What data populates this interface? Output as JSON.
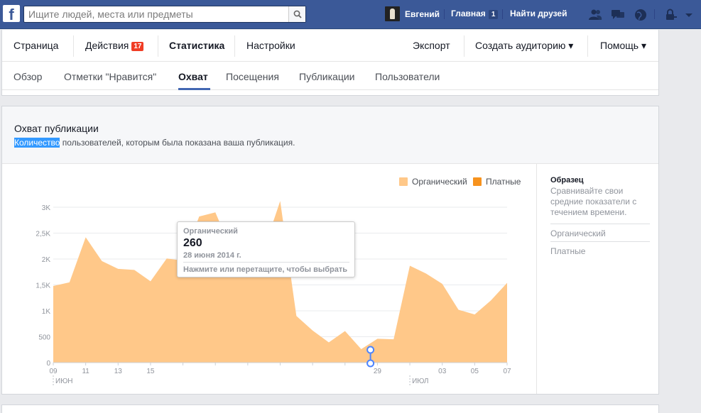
{
  "topbar": {
    "search_placeholder": "Ищите людей, места или предметы",
    "user_name": "Евгений",
    "home_label": "Главная",
    "home_count": "1",
    "find_friends": "Найти друзей",
    "icons": [
      "friend-requests-icon",
      "messages-icon",
      "notifications-globe-icon",
      "privacy-lock-icon",
      "account-menu-arrow-icon"
    ]
  },
  "tabs_primary": {
    "page": "Страница",
    "actions": "Действия",
    "actions_badge": "17",
    "stats": "Статистика",
    "settings": "Настройки",
    "export": "Экспорт",
    "create_audience": "Создать аудиторию ▾",
    "help": "Помощь ▾"
  },
  "tabs_secondary": {
    "overview": "Обзор",
    "likes": "Отметки \"Нравится\"",
    "reach": "Охват",
    "visits": "Посещения",
    "posts": "Публикации",
    "users": "Пользователи"
  },
  "card": {
    "title": "Охват публикации",
    "subtitle_highlight": "Количество",
    "subtitle_rest": " пользователей, которым была показана ваша публикация."
  },
  "legend": {
    "organic": "Органический",
    "paid": "Платные"
  },
  "colors": {
    "organic": "#ffc889",
    "paid": "#f7931e",
    "accent": "#4267b2",
    "topbar": "#3b5998"
  },
  "sidebar": {
    "title": "Образец",
    "description": "Сравнивайте свои средние показатели с течением времени.",
    "item_organic": "Органический",
    "item_paid": "Платные"
  },
  "tooltip": {
    "label": "Органический",
    "value": "260",
    "date": "28 июня 2014 г.",
    "hint": "Нажмите или перетащите, чтобы выбрать"
  },
  "chart_data": {
    "type": "area",
    "series_name": "Органический",
    "x_ticks": [
      "09",
      "11",
      "13",
      "15",
      "",
      "",
      "",
      "",
      "",
      "",
      "29",
      "",
      "03",
      "05",
      "07"
    ],
    "month_labels": [
      {
        "tick": "09",
        "label": "ИЮН"
      },
      {
        "tick": "01",
        "label": "ИЮЛ"
      }
    ],
    "y_ticks": [
      "0",
      "500",
      "1K",
      "1,5K",
      "2K",
      "2,5K",
      "3K"
    ],
    "ylim": [
      0,
      3000
    ],
    "x": [
      "06-09",
      "06-10",
      "06-11",
      "06-12",
      "06-13",
      "06-14",
      "06-15",
      "06-16",
      "06-17",
      "06-18",
      "06-19",
      "06-20",
      "06-21",
      "06-22",
      "06-23",
      "06-24",
      "06-25",
      "06-26",
      "06-27",
      "06-28",
      "06-29",
      "06-30",
      "07-01",
      "07-02",
      "07-03",
      "07-04",
      "07-05",
      "07-06",
      "07-07"
    ],
    "values": [
      1480,
      1550,
      2420,
      1960,
      1810,
      1790,
      1570,
      2010,
      1970,
      2820,
      2900,
      2170,
      1820,
      2190,
      3120,
      900,
      620,
      390,
      610,
      260,
      460,
      450,
      1870,
      1720,
      1520,
      1020,
      930,
      1200,
      1540
    ],
    "highlight_index": 19,
    "grid": true
  }
}
